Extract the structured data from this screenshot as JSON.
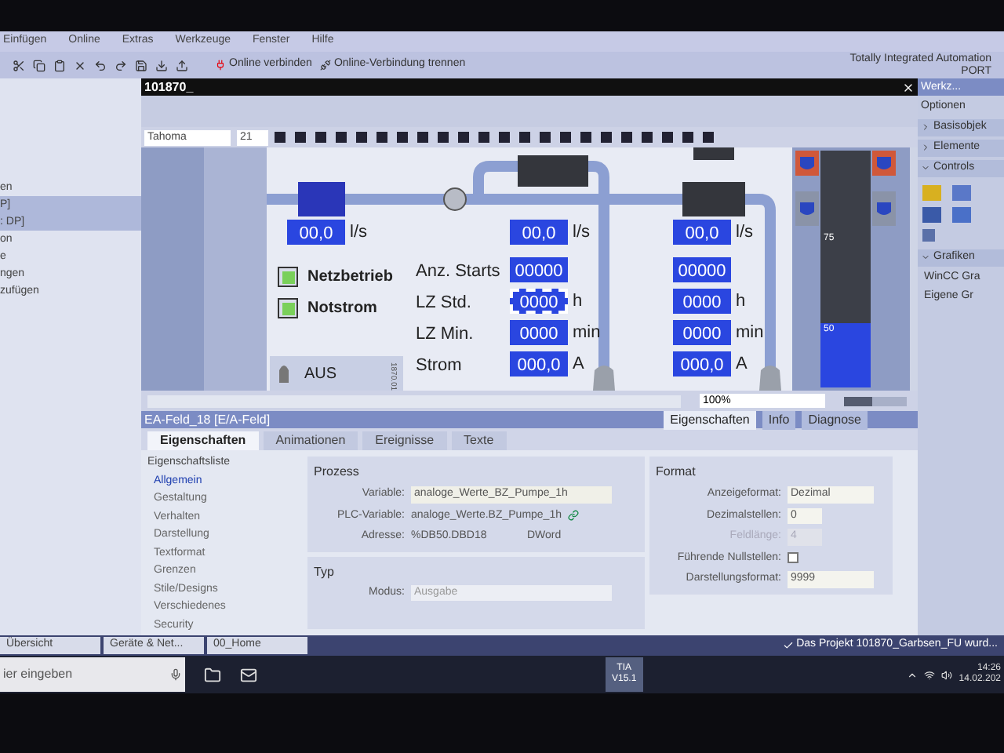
{
  "menu": [
    "Einfügen",
    "Online",
    "Extras",
    "Werkzeuge",
    "Fenster",
    "Hilfe"
  ],
  "toolbar": {
    "connect": "Online verbinden",
    "disconnect": "Online-Verbindung trennen",
    "brand": "Totally Integrated Automation",
    "brand_sub": "PORT"
  },
  "project_tree": {
    "items": [
      {
        "text": "en",
        "selected": false
      },
      {
        "text": "P]",
        "selected": true
      },
      {
        "text": ": DP]",
        "selected": true
      },
      {
        "text": "on",
        "selected": false
      },
      {
        "text": "e",
        "selected": false
      },
      {
        "text": "ngen",
        "selected": false
      },
      {
        "text": "zufügen",
        "selected": false
      }
    ]
  },
  "editor": {
    "title": "101870_",
    "font": "Tahoma",
    "font_size": "21",
    "zoom": "100%",
    "zoom_slider": {
      "level": 0.45
    }
  },
  "hmi": {
    "flow": {
      "value": "00,0",
      "unit": "l/s"
    },
    "indicators": [
      {
        "label": "Netzbetrieb",
        "on": true
      },
      {
        "label": "Notstrom",
        "on": true
      }
    ],
    "row_labels": [
      "Anz. Starts",
      "LZ Std.",
      "LZ Min.",
      "Strom"
    ],
    "pumps": [
      {
        "flow": {
          "value": "00,0",
          "unit": "l/s"
        },
        "rows": [
          {
            "value": "00000",
            "selected": false
          },
          {
            "value": "0000",
            "unit": "h",
            "selected": true
          },
          {
            "value": "0000",
            "unit": "min",
            "selected": false
          },
          {
            "value": "000,0",
            "unit": "A",
            "selected": false
          }
        ]
      },
      {
        "flow": {
          "value": "00,0",
          "unit": "l/s"
        },
        "rows": [
          {
            "value": "00000",
            "selected": false
          },
          {
            "value": "0000",
            "unit": "h",
            "selected": false
          },
          {
            "value": "0000",
            "unit": "min",
            "selected": false
          },
          {
            "value": "000,0",
            "unit": "A",
            "selected": false
          }
        ]
      }
    ],
    "aus_button": {
      "label": "AUS",
      "tag": "1870.01"
    },
    "tiles": [
      {
        "color": "#d0583a"
      },
      {
        "color": "#8a93a8"
      },
      {
        "color": "#d0583a"
      },
      {
        "color": "#8a93a8"
      }
    ],
    "gauge": {
      "ticks": [
        "75",
        "50"
      ],
      "level": 0.27
    }
  },
  "toolbox": {
    "title": "Werkz...",
    "options": "Optionen",
    "sections": [
      {
        "label": "Basisobjek",
        "expanded": false
      },
      {
        "label": "Elemente",
        "expanded": false
      },
      {
        "label": "Controls",
        "expanded": true
      },
      {
        "label": "Grafiken",
        "expanded": true
      }
    ],
    "graphics": [
      "WinCC Gra",
      "Eigene Gr"
    ]
  },
  "properties": {
    "title": "EA-Feld_18 [E/A-Feld]",
    "view_tabs": [
      {
        "label": "Eigenschaften",
        "selected": true
      },
      {
        "label": "Info",
        "selected": false
      },
      {
        "label": "Diagnose",
        "selected": false
      }
    ],
    "tabs": [
      {
        "label": "Eigenschaften",
        "selected": true
      },
      {
        "label": "Animationen",
        "selected": false
      },
      {
        "label": "Ereignisse",
        "selected": false
      },
      {
        "label": "Texte",
        "selected": false
      }
    ],
    "list_title": "Eigenschaftsliste",
    "list": [
      {
        "label": "Allgemein",
        "selected": true
      },
      {
        "label": "Gestaltung",
        "selected": false
      },
      {
        "label": "Verhalten",
        "selected": false
      },
      {
        "label": "Darstellung",
        "selected": false
      },
      {
        "label": "Textformat",
        "selected": false
      },
      {
        "label": "Grenzen",
        "selected": false
      },
      {
        "label": "Stile/Designs",
        "selected": false
      },
      {
        "label": "Verschiedenes",
        "selected": false
      },
      {
        "label": "Security",
        "selected": false
      }
    ],
    "process": {
      "title": "Prozess",
      "variable_label": "Variable:",
      "variable": "analoge_Werte_BZ_Pumpe_1h",
      "plc_label": "PLC-Variable:",
      "plc": "analoge_Werte.BZ_Pumpe_1h",
      "address_label": "Adresse:",
      "address": "%DB50.DBD18",
      "type": "DWord"
    },
    "typ": {
      "title": "Typ",
      "mode_label": "Modus:",
      "mode": "Ausgabe"
    },
    "format": {
      "title": "Format",
      "display_label": "Anzeigeformat:",
      "display": "Dezimal",
      "decimals_label": "Dezimalstellen:",
      "decimals": "0",
      "length_label": "Feldlänge:",
      "length": "4",
      "length_disabled": true,
      "leading_label": "Führende Nullstellen:",
      "leading_checked": false,
      "repr_label": "Darstellungsformat:",
      "repr": "9999"
    }
  },
  "editor_tabs": [
    "Übersicht",
    "Geräte & Net...",
    "00_Home"
  ],
  "status": "Das Projekt 101870_Garbsen_FU wurd...",
  "taskbar": {
    "search": "ier eingeben",
    "tia": "TIA",
    "tia_version": "V15.1",
    "time": "14:26",
    "date": "14.02.202"
  }
}
